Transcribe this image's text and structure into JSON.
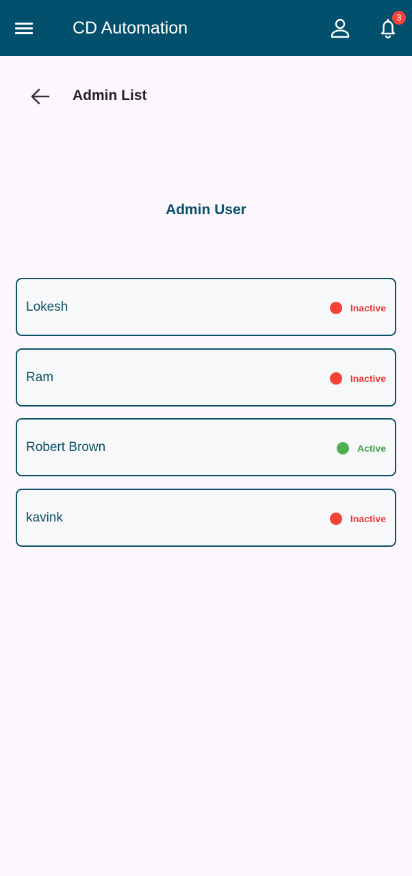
{
  "appbar": {
    "title": "CD Automation",
    "menu_icon": "hamburger-menu-icon",
    "profile_icon": "person-icon",
    "notification_icon": "bell-icon",
    "notification_count": "3",
    "background_color": "#02506d"
  },
  "page": {
    "back_icon": "arrow-left-icon",
    "title": "Admin List",
    "section_heading": "Admin User"
  },
  "status_colors": {
    "active": "#4caf50",
    "inactive": "#f44336",
    "active_text": "#43a047",
    "inactive_text": "#e53935"
  },
  "users": [
    {
      "name": "Lokesh",
      "status": "Inactive"
    },
    {
      "name": "Ram",
      "status": "Inactive"
    },
    {
      "name": "Robert Brown",
      "status": "Active"
    },
    {
      "name": "kavink",
      "status": "Inactive"
    }
  ]
}
